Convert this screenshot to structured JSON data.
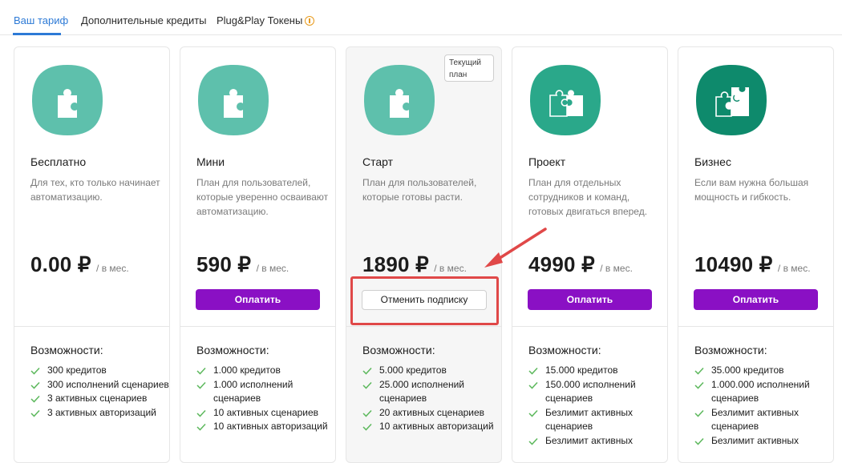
{
  "tabs": [
    {
      "label": "Ваш тариф",
      "active": true
    },
    {
      "label": "Дополнительные кредиты",
      "active": false
    },
    {
      "label": "Plug&Play Токены",
      "active": false,
      "icon": "coin-icon"
    }
  ],
  "colors": {
    "accent": "#2d7ad6",
    "pay_button": "#8a10c4",
    "highlight": "#e04848",
    "check": "#5cb85c",
    "plan_icon_light": "#5ec0ac",
    "plan_icon_mid": "#2aa88a",
    "plan_icon_dark": "#0e8a6c"
  },
  "common": {
    "per_month": "/ в мес.",
    "features_title": "Возможности:",
    "pay_label": "Оплатить"
  },
  "plans": [
    {
      "name": "Бесплатно",
      "description": "Для тех, кто только начинает автоматизацию.",
      "price": "0.00 ₽",
      "button": null,
      "features": [
        "300 кредитов",
        "300 исполнений сценариев",
        "3 активных сценариев",
        "3 активных авторизаций"
      ]
    },
    {
      "name": "Мини",
      "description": "План для пользователей, которые уверенно осваивают автоматизацию.",
      "price": "590 ₽",
      "button": "pay",
      "features": [
        "1.000 кредитов",
        "1.000 исполнений сценариев",
        "10 активных сценариев",
        "10 активных авторизаций"
      ]
    },
    {
      "name": "Старт",
      "description": "План для пользователей, которые готовы расти.",
      "price": "1890 ₽",
      "button": "cancel",
      "cancel_label": "Отменить подписку",
      "badge": "Текущий план",
      "features": [
        "5.000 кредитов",
        "25.000 исполнений сценариев",
        "20 активных сценариев",
        "10 активных авторизаций"
      ]
    },
    {
      "name": "Проект",
      "description": "План для отдельных сотрудников и команд, готовых двигаться вперед.",
      "price": "4990 ₽",
      "button": "pay",
      "features": [
        "15.000 кредитов",
        "150.000 исполнений сценариев",
        "Безлимит активных сценариев",
        "Безлимит активных"
      ]
    },
    {
      "name": "Бизнес",
      "description": "Если вам нужна большая мощность и гибкость.",
      "price": "10490 ₽",
      "button": "pay",
      "features": [
        "35.000 кредитов",
        "1.000.000 исполнений сценариев",
        "Безлимит активных сценариев",
        "Безлимит активных"
      ]
    }
  ]
}
